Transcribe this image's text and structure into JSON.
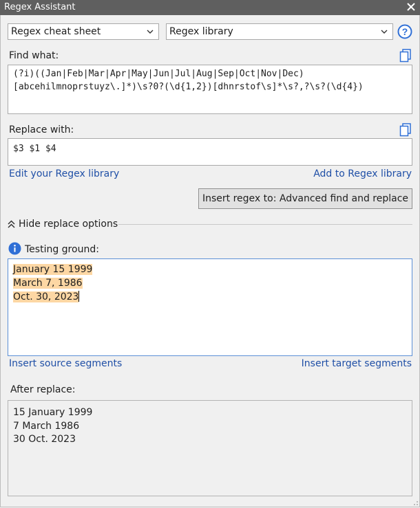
{
  "window": {
    "title": "Regex Assistant"
  },
  "selectors": {
    "cheat_sheet": "Regex cheat sheet",
    "library": "Regex library"
  },
  "find": {
    "label": "Find what:",
    "line1": "(?i)((Jan|Feb|Mar|Apr|May|Jun|Jul|Aug|Sep|Oct|Nov|Dec)",
    "line2": "[abcehilmnoprstuyz\\.]*)\\s?0?(\\d{1,2})[dhnrstof\\s]*\\s?,?\\s?(\\d{4})"
  },
  "replace": {
    "label": "Replace with:",
    "value": "$3 $1 $4"
  },
  "links": {
    "edit_library": "Edit your Regex library",
    "add_library": "Add to Regex library",
    "insert_source": "Insert source segments",
    "insert_target": "Insert target segments"
  },
  "insert_button": "Insert regex to: Advanced find and replace",
  "toggle": {
    "label": "Hide replace options"
  },
  "testing": {
    "label": "Testing ground:",
    "lines": [
      "January 15 1999",
      "March 7, 1986",
      "Oct. 30, 2023"
    ]
  },
  "after": {
    "label": "After replace:",
    "lines": [
      "15 January 1999",
      "7 March 1986",
      "30 Oct. 2023"
    ]
  },
  "colors": {
    "titlebar": "#5f5f5f",
    "link": "#1f4fa6",
    "highlight": "#fdd7a4",
    "info_icon": "#2f6fd6"
  }
}
